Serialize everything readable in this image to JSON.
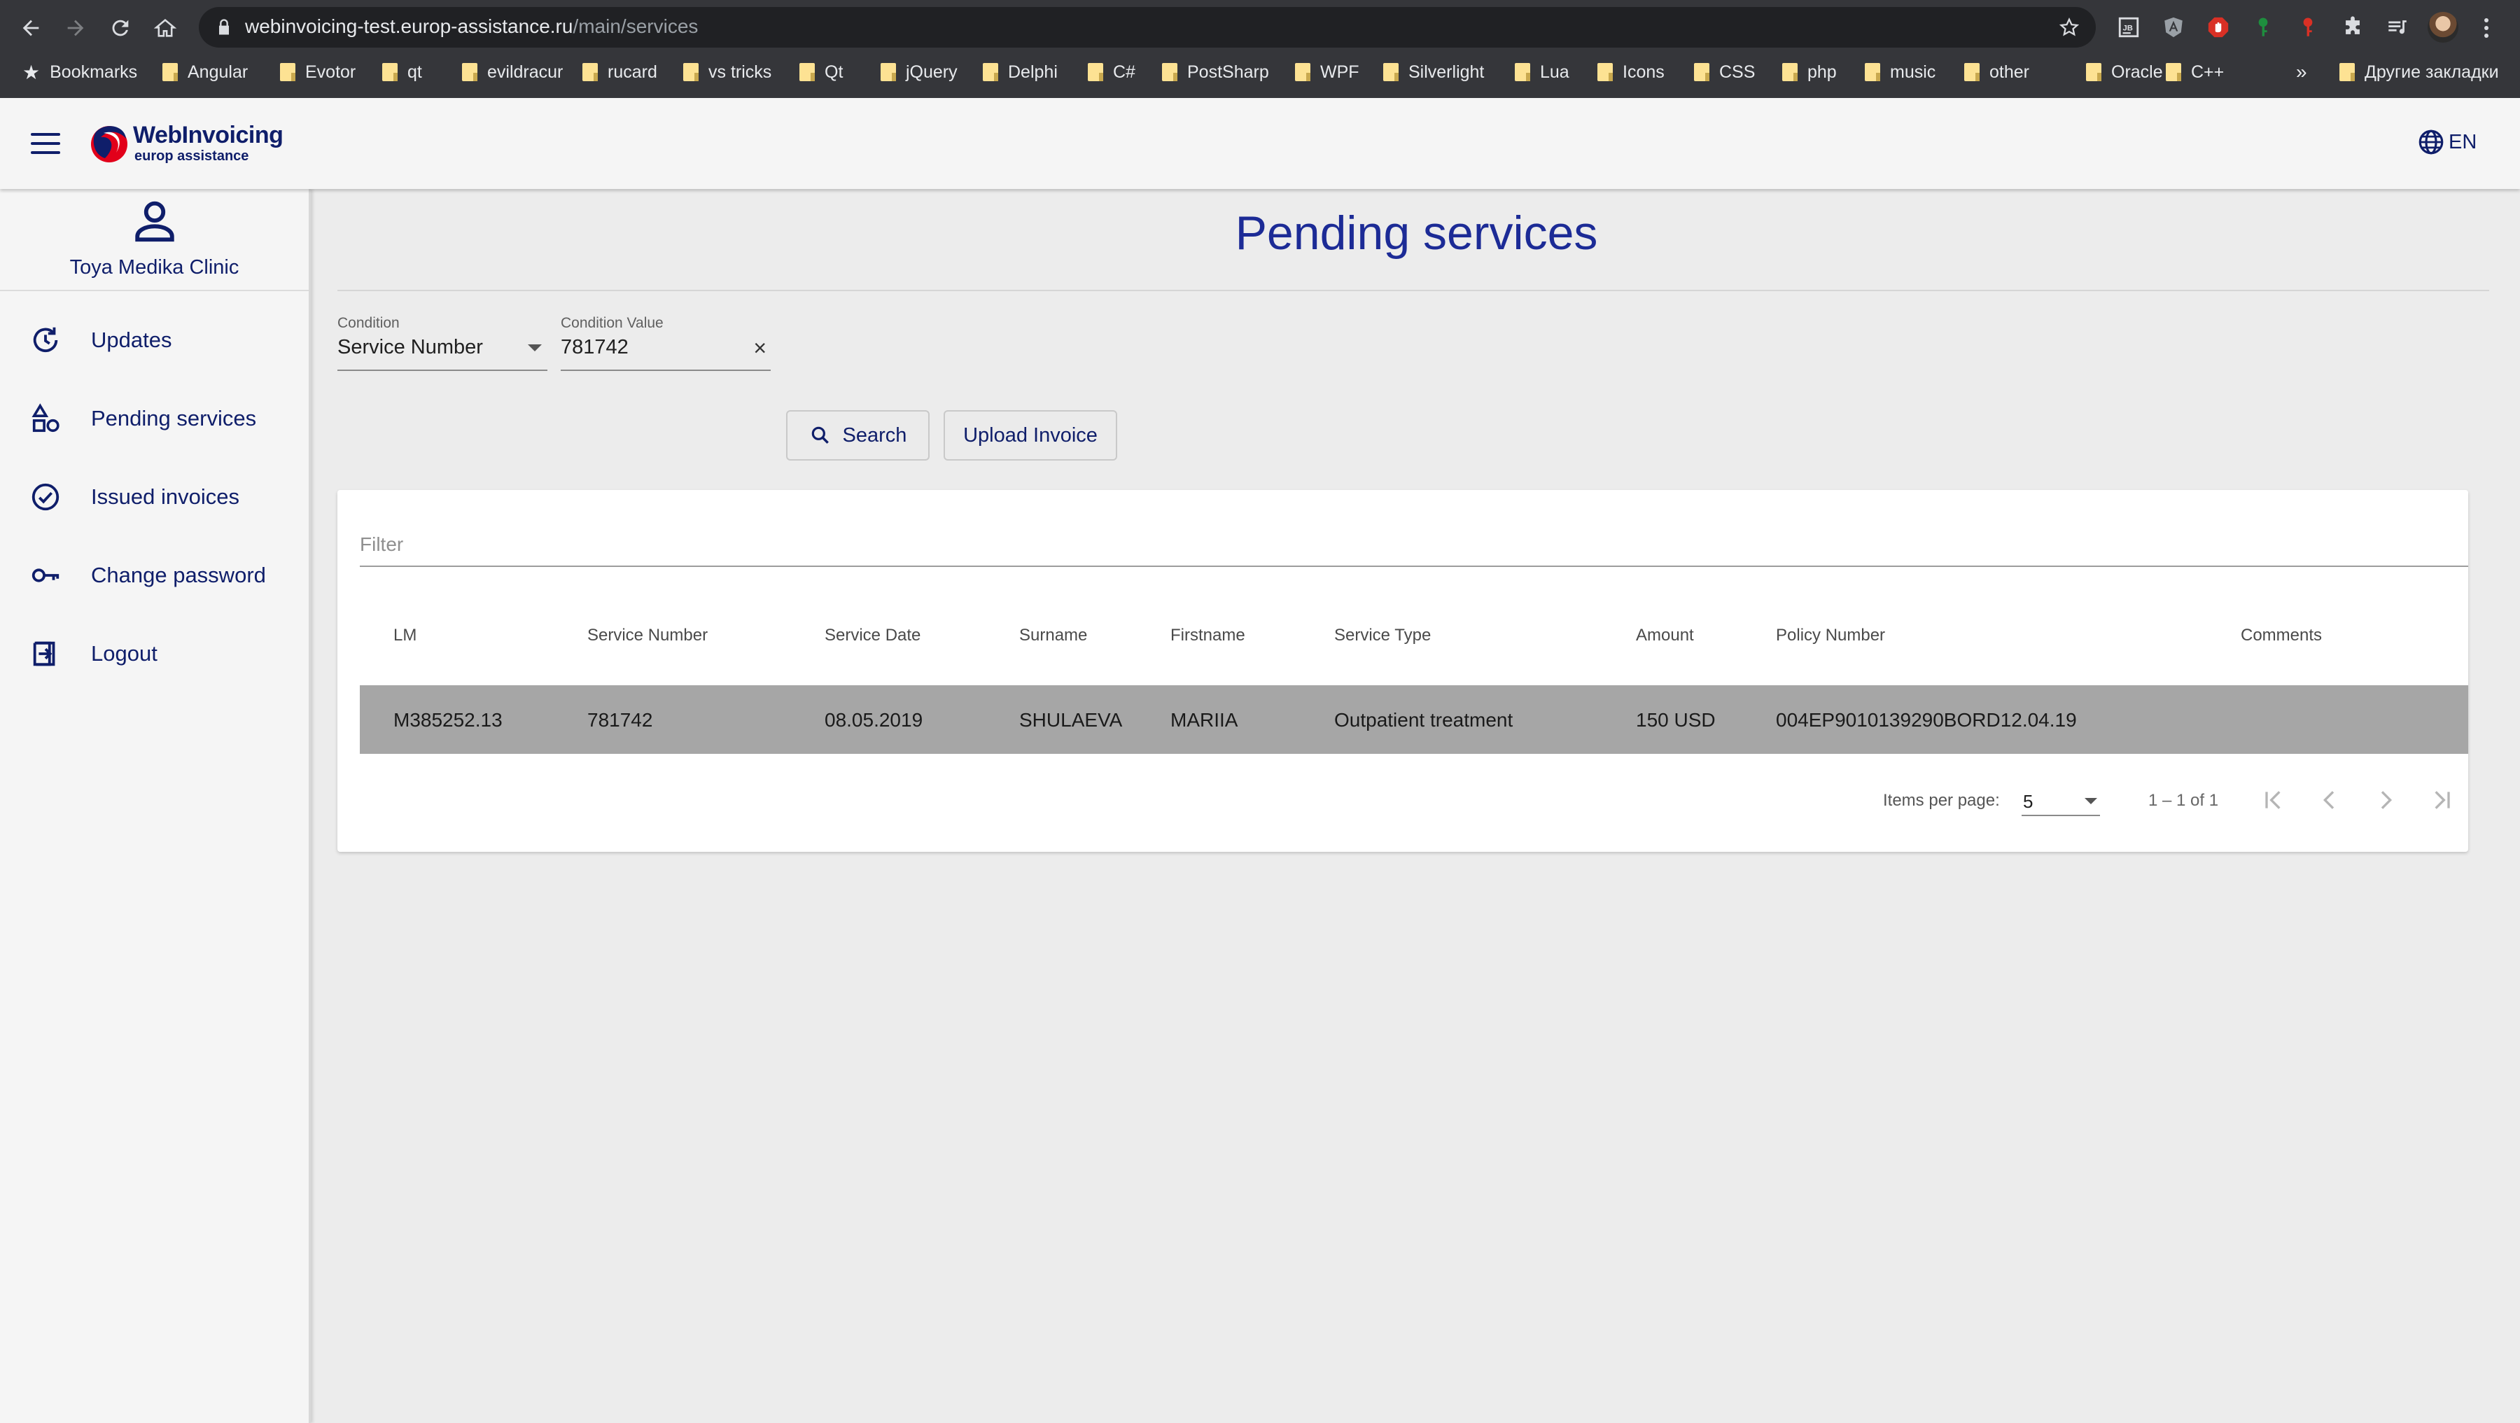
{
  "browser": {
    "url_host": "webinvoicing-test.europ-assistance.ru",
    "url_path": "/main/services",
    "bookmarks_label": "Bookmarks",
    "bookmarks": [
      "Angular",
      "Evotor",
      "qt",
      "evildracur",
      "rucard",
      "vs tricks",
      "Qt",
      "jQuery",
      "Delphi",
      "C#",
      "PostSharp",
      "WPF",
      "Silverlight",
      "Lua",
      "Icons",
      "CSS",
      "php",
      "music",
      "other",
      "Oracle",
      "C++"
    ],
    "more_label": "»",
    "other_bookmarks": "Другие закладки"
  },
  "app": {
    "logo_title": "WebInvoicing",
    "logo_subtitle": "europ assistance",
    "language": "EN",
    "user_name": "Toya Medika Clinic",
    "nav": [
      {
        "label": "Updates",
        "icon": "refresh-icon"
      },
      {
        "label": "Pending services",
        "icon": "shapes-icon"
      },
      {
        "label": "Issued invoices",
        "icon": "check-circle-icon"
      },
      {
        "label": "Change password",
        "icon": "key-icon"
      },
      {
        "label": "Logout",
        "icon": "logout-icon"
      }
    ]
  },
  "page": {
    "title": "Pending services",
    "condition_label": "Condition",
    "condition_value": "Service Number",
    "condition_value_label": "Condition Value",
    "condition_value_input": "781742",
    "search_label": "Search",
    "upload_label": "Upload Invoice",
    "filter_placeholder": "Filter"
  },
  "table": {
    "columns": [
      "LM",
      "Service Number",
      "Service Date",
      "Surname",
      "Firstname",
      "Service Type",
      "Amount",
      "Policy Number",
      "Comments"
    ],
    "rows": [
      [
        "M385252.13",
        "781742",
        "08.05.2019",
        "SHULAEVA",
        "MARIIA",
        "Outpatient treatment",
        "150 USD",
        "004EP9010139290BORD12.04.19",
        ""
      ]
    ]
  },
  "pager": {
    "items_per_page_label": "Items per page:",
    "items_per_page": "5",
    "range": "1 – 1 of 1"
  },
  "colors": {
    "brand_navy": "#0f1e6a",
    "title_blue": "#1c2b96",
    "logo_red": "#e2001a",
    "row_selected": "#a6a6a6"
  }
}
